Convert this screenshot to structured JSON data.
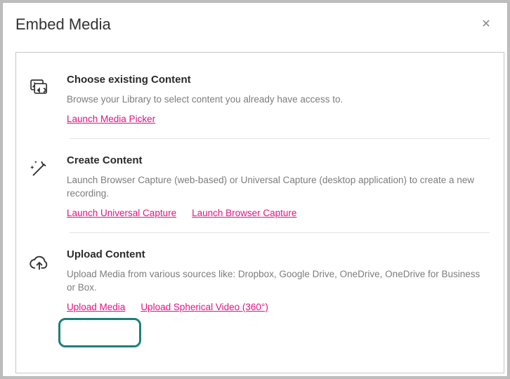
{
  "dialog": {
    "title": "Embed Media",
    "close_aria": "Close"
  },
  "sections": {
    "existing": {
      "title": "Choose existing Content",
      "desc": "Browse your Library to select content you already have access to.",
      "link_picker": "Launch Media Picker"
    },
    "create": {
      "title": "Create Content",
      "desc": "Launch Browser Capture (web-based) or Universal Capture (desktop application) to create a new recording.",
      "link_universal": "Launch Universal Capture",
      "link_browser": "Launch Browser Capture"
    },
    "upload": {
      "title": "Upload Content",
      "desc": "Upload Media from various sources like: Dropbox, Google Drive, OneDrive, OneDrive for Business or Box.",
      "link_upload": "Upload Media",
      "link_spherical": "Upload Spherical Video (360°)"
    }
  },
  "colors": {
    "link": "#e21285",
    "highlight": "#1f7f7a"
  }
}
